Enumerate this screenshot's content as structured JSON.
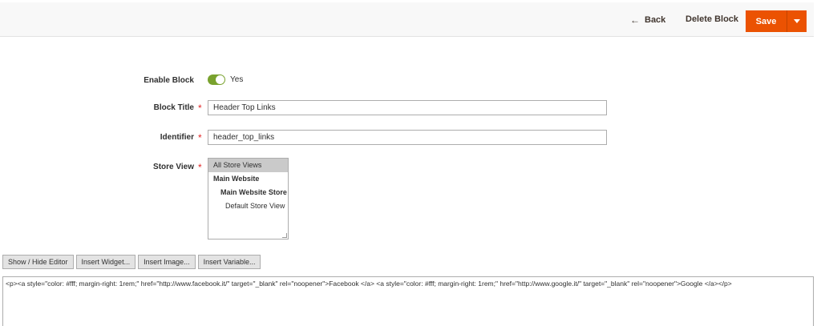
{
  "header": {
    "back_label": "Back",
    "back_icon": "arrow-left-icon",
    "delete_label": "Delete Block",
    "save_label": "Save",
    "save_menu_icon": "caret-down-icon",
    "accent_color": "#eb5202"
  },
  "form": {
    "enable_block": {
      "label": "Enable Block",
      "value": "Yes",
      "on": true
    },
    "block_title": {
      "label": "Block Title",
      "value": "Header Top Links"
    },
    "identifier": {
      "label": "Identifier",
      "value": "header_top_links"
    },
    "store_view": {
      "label": "Store View",
      "options": [
        "All Store Views",
        "Main Website",
        "Main Website Store",
        "Default Store View"
      ],
      "selected": "All Store Views"
    },
    "required_marker": "*"
  },
  "editor": {
    "buttons": [
      "Show / Hide Editor",
      "Insert Widget...",
      "Insert Image...",
      "Insert Variable..."
    ],
    "content": "<p><a style=\"color: #fff; margin-right: 1rem;\" href=\"http://www.facebook.it/\" target=\"_blank\" rel=\"noopener\">Facebook </a> <a style=\"color: #fff; margin-right: 1rem;\" href=\"http://www.google.it/\" target=\"_blank\" rel=\"noopener\">Google </a></p>"
  }
}
